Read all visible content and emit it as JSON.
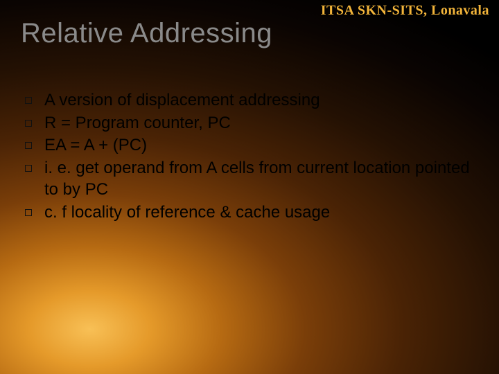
{
  "watermark": "ITSA SKN-SITS, Lonavala",
  "title": "Relative Addressing",
  "bullets": [
    "A version of displacement addressing",
    "R = Program counter, PC",
    "EA = A + (PC)",
    "i. e. get operand from A cells from current location pointed to by PC",
    "c. f locality of reference & cache usage"
  ]
}
